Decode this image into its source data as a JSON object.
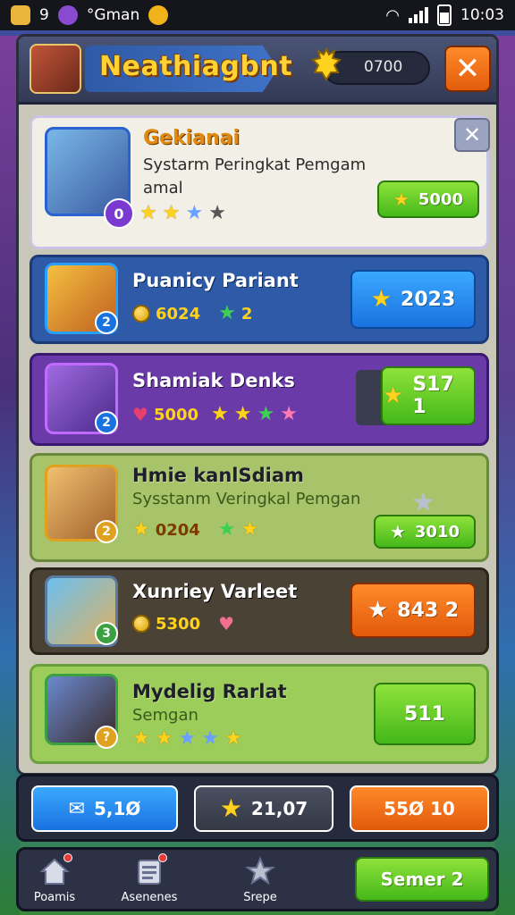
{
  "status_bar": {
    "left_text_1": "9",
    "left_text_2": "°Gman",
    "time": "10:03"
  },
  "header": {
    "title": "Neathiagbnt",
    "currency_value": "0700",
    "close_symbol": "✕"
  },
  "cards": [
    {
      "name": "Gekianai",
      "subtitle": "Systarm Peringkat Pemgam",
      "subtitle2": "amal",
      "badge": "0",
      "button_value": "5000",
      "close_symbol": "✕",
      "stars": [
        "y",
        "y",
        "b",
        "gr"
      ]
    },
    {
      "name": "Puanicy Pariant",
      "badge": "2",
      "coin_value": "6024",
      "green_star_value": "2",
      "button_value": "2023"
    },
    {
      "name": "Shamiak Denks",
      "badge": "2",
      "heart_value": "5000",
      "button_value": "S17 1",
      "stars": [
        "y",
        "y",
        "g",
        "pk"
      ]
    },
    {
      "name": "Hmie kanlSdiam",
      "subtitle": "Sysstanm Veringkal Pemgan",
      "badge": "2",
      "coin_value": "0204",
      "button_value": "3010"
    },
    {
      "name": "Xunriey Varleet",
      "badge": "3",
      "coin_value": "5300",
      "button_value": "843 2"
    },
    {
      "name": "Mydelig Rarlat",
      "subtitle": "Semgan",
      "badge": "?",
      "button_value": "511",
      "stars": [
        "y",
        "y",
        "b",
        "b",
        "y"
      ]
    }
  ],
  "strip": {
    "left_value": "5,1Ø",
    "middle_value": "21,07",
    "right_value": "55Ø 10"
  },
  "nav": {
    "items": [
      "Poamis",
      "Asenenes",
      "Srepe"
    ],
    "button_label": "Semer 2"
  },
  "colors": {
    "accent_gold": "#ffd233",
    "green": "#45b81a",
    "blue": "#1a72e0",
    "orange": "#e25a0b"
  }
}
